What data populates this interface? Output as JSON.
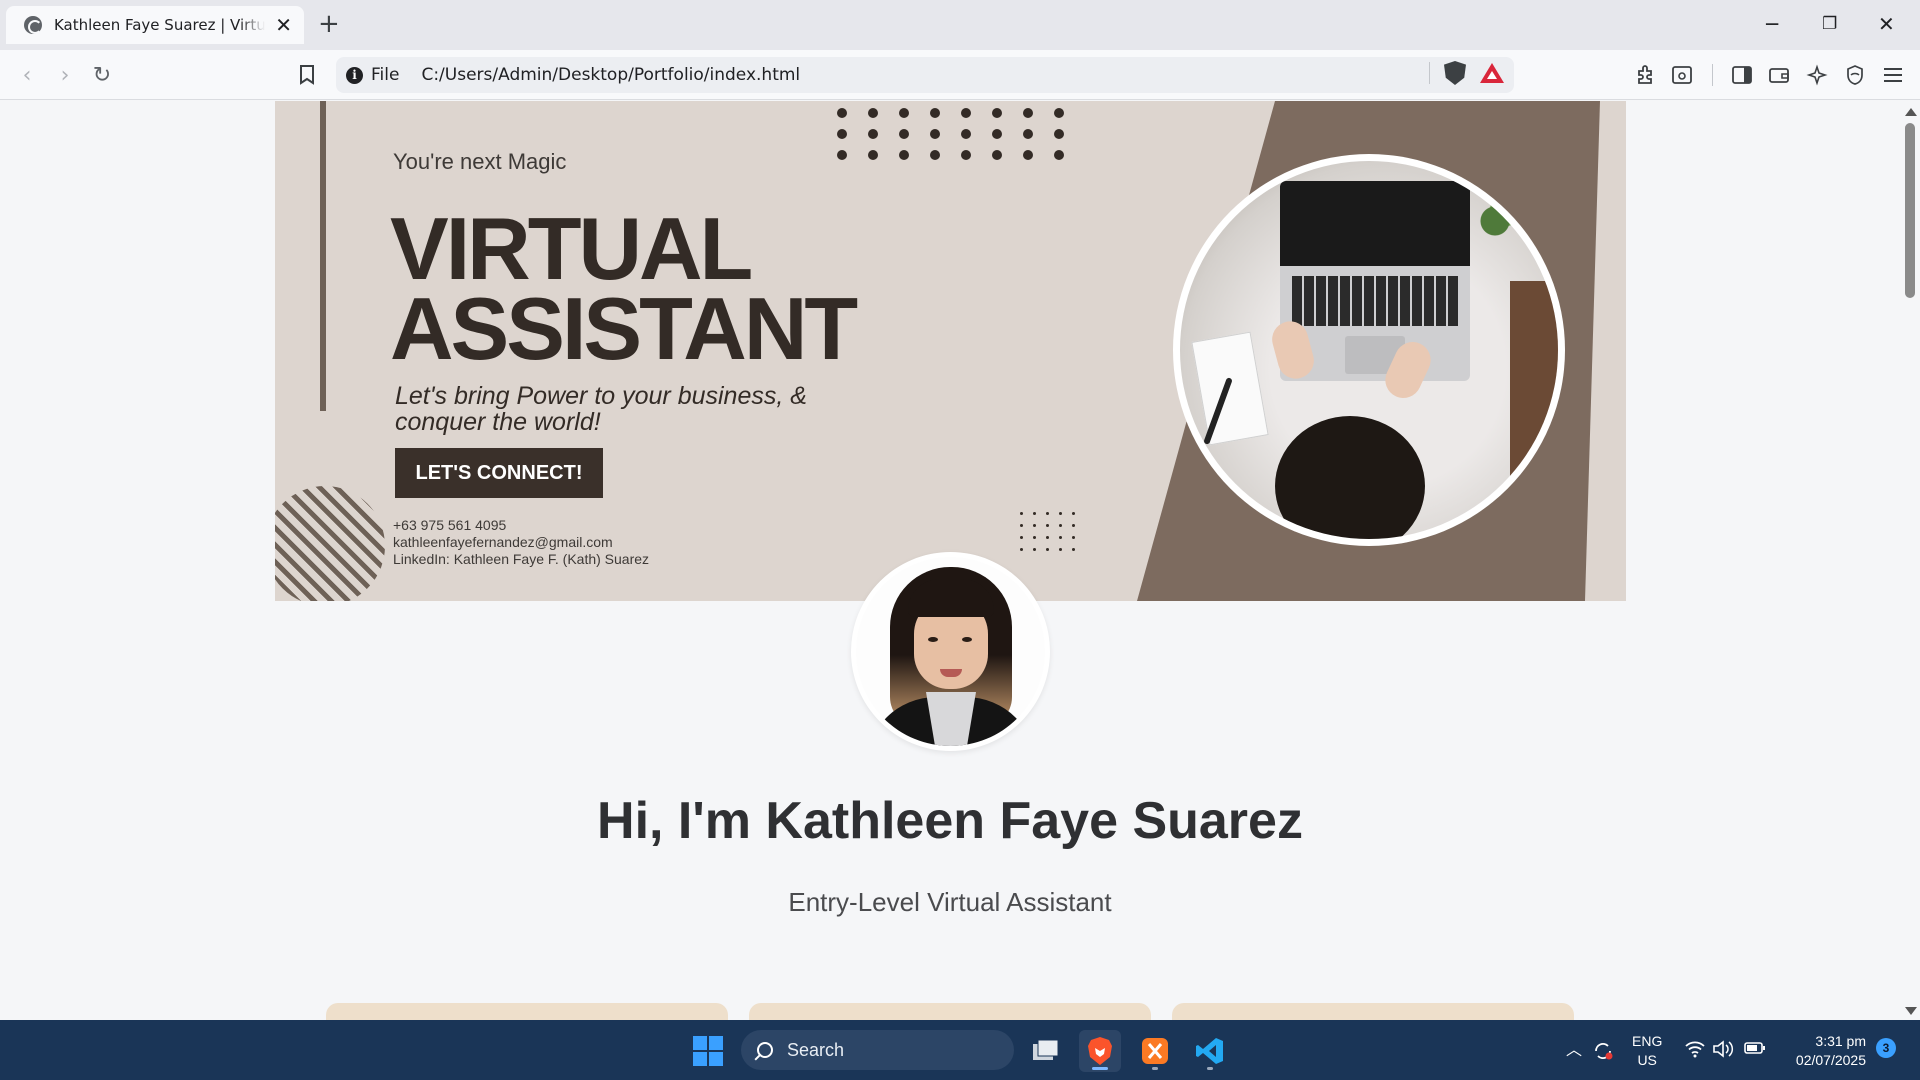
{
  "browser": {
    "tab_title": "Kathleen Faye Suarez | Virtual Assistant",
    "address_scheme_label": "File",
    "url": "C:/Users/Admin/Desktop/Portfolio/index.html"
  },
  "icons": {
    "back": "back-arrow-icon",
    "forward": "forward-arrow-icon",
    "reload": "reload-icon",
    "bookmark": "bookmark-icon",
    "shield": "brave-shields-icon",
    "rewards": "brave-rewards-icon",
    "extensions": "extensions-icon",
    "sidebar": "sidebar-icon",
    "wallet": "wallet-icon",
    "leo": "leo-ai-icon",
    "vpn": "vpn-icon",
    "menu": "menu-icon"
  },
  "banner": {
    "subtitle": "You're next Magic",
    "title_line1": "VIRTUAL",
    "title_line2": "ASSISTANT",
    "tagline": "Let's bring Power to your business, & conquer the world!",
    "cta_label": "LET'S CONNECT!",
    "phone": "+63 975 561 4095",
    "email": "kathleenfayefernandez@gmail.com",
    "linkedin": "LinkedIn: Kathleen Faye F. (Kath) Suarez"
  },
  "hero": {
    "name": "Hi, I'm Kathleen Faye Suarez",
    "role": "Entry-Level Virtual Assistant"
  },
  "taskbar": {
    "search_label": "Search",
    "lang_line1": "ENG",
    "lang_line2": "US",
    "time": "3:31 pm",
    "date": "02/07/2025",
    "notification_count": "3"
  },
  "colors": {
    "banner_bg": "#ddd5cf",
    "banner_dark": "#7d6b5f",
    "banner_text": "#332b26",
    "card_bg": "#eedfcb",
    "taskbar_bg": "#1a3557",
    "accent_blue": "#3aa0ff"
  }
}
